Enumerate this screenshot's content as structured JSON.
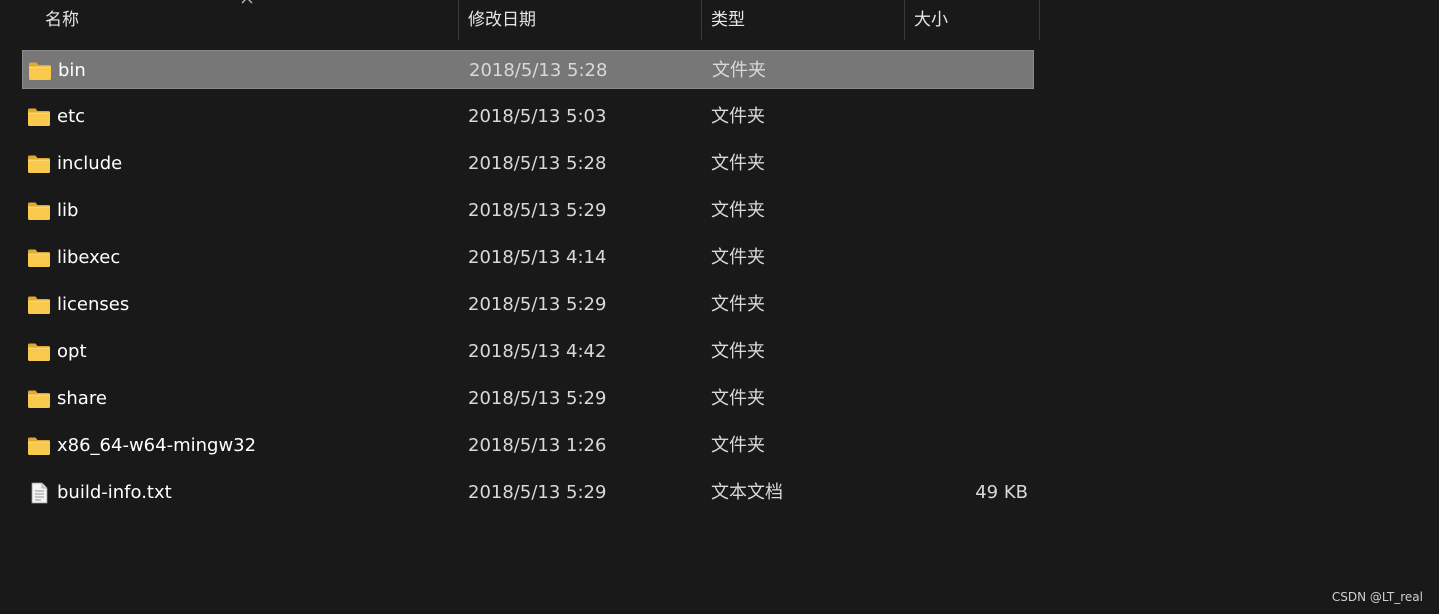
{
  "columns": {
    "name": "名称",
    "date": "修改日期",
    "type": "类型",
    "size": "大小"
  },
  "sort": {
    "column": "name",
    "direction": "ascending",
    "icon": "chevron-up-icon"
  },
  "rows": [
    {
      "name": "bin",
      "date": "2018/5/13 5:28",
      "type": "文件夹",
      "size": "",
      "icon": "folder-icon",
      "selected": true
    },
    {
      "name": "etc",
      "date": "2018/5/13 5:03",
      "type": "文件夹",
      "size": "",
      "icon": "folder-icon",
      "selected": false
    },
    {
      "name": "include",
      "date": "2018/5/13 5:28",
      "type": "文件夹",
      "size": "",
      "icon": "folder-icon",
      "selected": false
    },
    {
      "name": "lib",
      "date": "2018/5/13 5:29",
      "type": "文件夹",
      "size": "",
      "icon": "folder-icon",
      "selected": false
    },
    {
      "name": "libexec",
      "date": "2018/5/13 4:14",
      "type": "文件夹",
      "size": "",
      "icon": "folder-icon",
      "selected": false
    },
    {
      "name": "licenses",
      "date": "2018/5/13 5:29",
      "type": "文件夹",
      "size": "",
      "icon": "folder-icon",
      "selected": false
    },
    {
      "name": "opt",
      "date": "2018/5/13 4:42",
      "type": "文件夹",
      "size": "",
      "icon": "folder-icon",
      "selected": false
    },
    {
      "name": "share",
      "date": "2018/5/13 5:29",
      "type": "文件夹",
      "size": "",
      "icon": "folder-icon",
      "selected": false
    },
    {
      "name": "x86_64-w64-mingw32",
      "date": "2018/5/13 1:26",
      "type": "文件夹",
      "size": "",
      "icon": "folder-icon",
      "selected": false
    },
    {
      "name": "build-info.txt",
      "date": "2018/5/13 5:29",
      "type": "文本文档",
      "size": "49 KB",
      "icon": "text-file-icon",
      "selected": false
    }
  ],
  "watermark": "CSDN @LT_real",
  "colors": {
    "background": "#191919",
    "selected_row": "#777777",
    "folder": "#f8c94c"
  }
}
